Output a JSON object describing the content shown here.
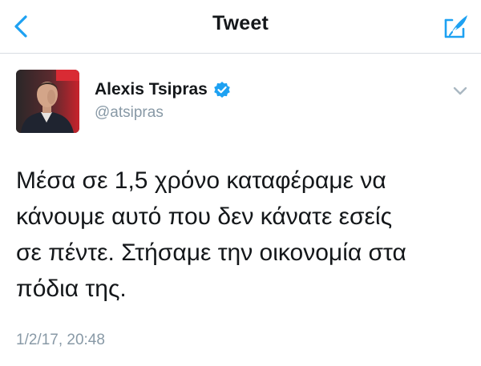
{
  "nav": {
    "title": "Tweet",
    "back_icon": "chevron-left-icon",
    "compose_icon": "compose-tweet-icon"
  },
  "tweet": {
    "author_name": "Alexis Tsipras",
    "author_handle": "@atsipras",
    "verified": true,
    "text": "Μέσα σε 1,5  χρόνο καταφέραμε να\nκάνουμε αυτό που δεν κάνατε εσείς\nσε πέντε. Στήσαμε την οικονομία στα\nπόδια της.",
    "timestamp": "1/2/17, 20:48",
    "menu_icon": "chevron-down-icon"
  },
  "colors": {
    "accent": "#1da1f2",
    "text": "#14171a",
    "secondary_text": "#8899a6",
    "divider": "#d8dde2"
  }
}
